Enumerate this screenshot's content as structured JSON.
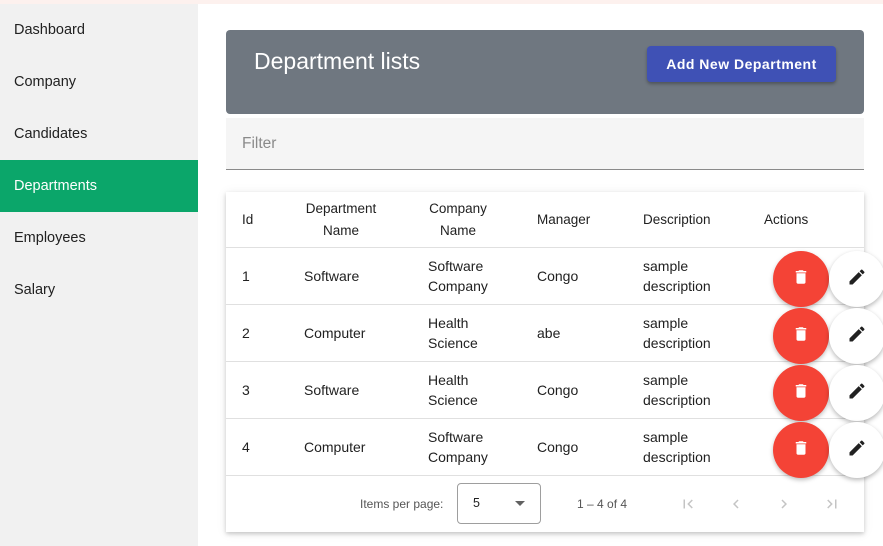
{
  "sidebar": {
    "items": [
      {
        "label": "Dashboard",
        "active": false
      },
      {
        "label": "Company",
        "active": false
      },
      {
        "label": "Candidates",
        "active": false
      },
      {
        "label": "Departments",
        "active": true
      },
      {
        "label": "Employees",
        "active": false
      },
      {
        "label": "Salary",
        "active": false
      }
    ]
  },
  "header": {
    "title": "Department lists",
    "add_button_label": "Add New Department"
  },
  "filter": {
    "placeholder": "Filter"
  },
  "table": {
    "headers": {
      "id": "Id",
      "dept_name_1": "Department",
      "dept_name_2": "Name",
      "company_name_1": "Company",
      "company_name_2": "Name",
      "manager": "Manager",
      "description": "Description",
      "actions": "Actions"
    },
    "rows": [
      {
        "id": "1",
        "department": "Software",
        "company_1": "Software",
        "company_2": "Company",
        "manager": "Congo",
        "description_1": "sample",
        "description_2": "description"
      },
      {
        "id": "2",
        "department": "Computer",
        "company_1": "Health",
        "company_2": "Science",
        "manager": "abe",
        "description_1": "sample",
        "description_2": "description"
      },
      {
        "id": "3",
        "department": "Software",
        "company_1": "Health",
        "company_2": "Science",
        "manager": "Congo",
        "description_1": "sample",
        "description_2": "description"
      },
      {
        "id": "4",
        "department": "Computer",
        "company_1": "Software",
        "company_2": "Company",
        "manager": "Congo",
        "description_1": "sample",
        "description_2": "description"
      }
    ],
    "row_actions": {
      "delete_icon": "trash-icon",
      "edit_icon": "pencil-icon"
    }
  },
  "paginator": {
    "items_per_page_label": "Items per page:",
    "page_size": "5",
    "range_label": "1 – 4 of 4"
  },
  "colors": {
    "sidebar_active": "#0ba66a",
    "header_bg": "#6f7780",
    "primary_button": "#3f51b5",
    "delete_button": "#f44336"
  }
}
